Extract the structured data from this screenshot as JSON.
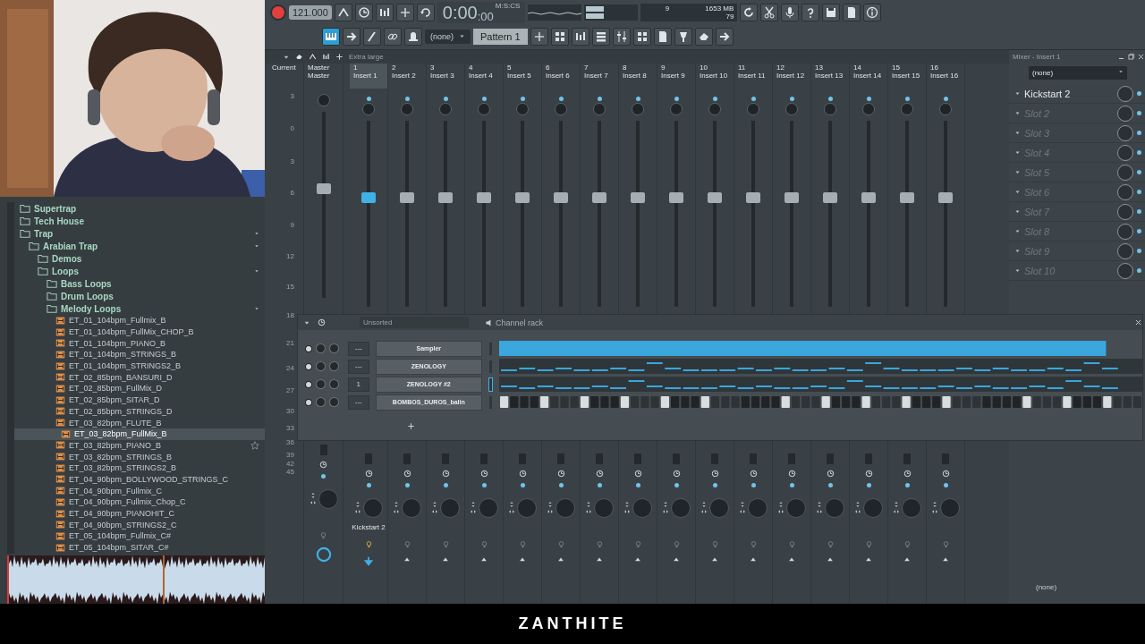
{
  "toolbar": {
    "tempo": "121.000",
    "time": "0:00",
    "time_cs": ":00",
    "time_format": "M:S:CS",
    "cpu": "9",
    "memory": "1653 MB",
    "polyphony": "79",
    "pattern_select": "(none)",
    "pattern": "Pattern 1"
  },
  "browser": {
    "tree": [
      {
        "name": "Supertrap",
        "kind": "folder",
        "expanded": false,
        "selected": false
      },
      {
        "name": "Tech House",
        "kind": "folder",
        "expanded": false,
        "selected": false
      },
      {
        "name": "Trap",
        "kind": "folder",
        "expanded": true,
        "selected": false,
        "children": [
          {
            "name": "Arabian Trap",
            "kind": "folder",
            "expanded": true,
            "selected": false,
            "children": [
              {
                "name": "Demos",
                "kind": "folder",
                "expanded": false,
                "selected": false
              },
              {
                "name": "Loops",
                "kind": "folder",
                "expanded": true,
                "selected": false,
                "children": [
                  {
                    "name": "Bass Loops",
                    "kind": "folder",
                    "expanded": false,
                    "selected": false
                  },
                  {
                    "name": "Drum Loops",
                    "kind": "folder",
                    "expanded": false,
                    "selected": false
                  },
                  {
                    "name": "Melody Loops",
                    "kind": "folder",
                    "expanded": true,
                    "selected": false,
                    "children": [
                      {
                        "name": "ET_01_104bpm_Fullmix_B",
                        "kind": "file",
                        "selected": false,
                        "favorite": false
                      },
                      {
                        "name": "ET_01_104bpm_FullMix_CHOP_B",
                        "kind": "file",
                        "selected": false,
                        "favorite": false
                      },
                      {
                        "name": "ET_01_104bpm_PIANO_B",
                        "kind": "file",
                        "selected": false,
                        "favorite": false
                      },
                      {
                        "name": "ET_01_104bpm_STRINGS_B",
                        "kind": "file",
                        "selected": false,
                        "favorite": false
                      },
                      {
                        "name": "ET_01_104bpm_STRINGS2_B",
                        "kind": "file",
                        "selected": false,
                        "favorite": false
                      },
                      {
                        "name": "ET_02_85bpm_BANSURI_D",
                        "kind": "file",
                        "selected": false,
                        "favorite": false
                      },
                      {
                        "name": "ET_02_85bpm_FullMix_D",
                        "kind": "file",
                        "selected": false,
                        "favorite": false
                      },
                      {
                        "name": "ET_02_85bpm_SITAR_D",
                        "kind": "file",
                        "selected": false,
                        "favorite": false
                      },
                      {
                        "name": "ET_02_85bpm_STRINGS_D",
                        "kind": "file",
                        "selected": false,
                        "favorite": false
                      },
                      {
                        "name": "ET_03_82bpm_FLUTE_B",
                        "kind": "file",
                        "selected": false,
                        "favorite": false
                      },
                      {
                        "name": "ET_03_82bpm_FullMix_B",
                        "kind": "file",
                        "selected": true,
                        "favorite": false
                      },
                      {
                        "name": "ET_03_82bpm_PIANO_B",
                        "kind": "file",
                        "selected": false,
                        "favorite": true
                      },
                      {
                        "name": "ET_03_82bpm_STRINGS_B",
                        "kind": "file",
                        "selected": false,
                        "favorite": false
                      },
                      {
                        "name": "ET_03_82bpm_STRINGS2_B",
                        "kind": "file",
                        "selected": false,
                        "favorite": false
                      },
                      {
                        "name": "ET_04_90bpm_BOLLYWOOD_STRINGS_C",
                        "kind": "file",
                        "selected": false,
                        "favorite": false
                      },
                      {
                        "name": "ET_04_90bpm_Fullmix_C",
                        "kind": "file",
                        "selected": false,
                        "favorite": false
                      },
                      {
                        "name": "ET_04_90bpm_Fullmix_Chop_C",
                        "kind": "file",
                        "selected": false,
                        "favorite": false
                      },
                      {
                        "name": "ET_04_90bpm_PIANOHIT_C",
                        "kind": "file",
                        "selected": false,
                        "favorite": false
                      },
                      {
                        "name": "ET_04_90bpm_STRINGS2_C",
                        "kind": "file",
                        "selected": false,
                        "favorite": false
                      },
                      {
                        "name": "ET_05_104bpm_Fullmix_C#",
                        "kind": "file",
                        "selected": false,
                        "favorite": false
                      },
                      {
                        "name": "ET_05_104bpm_SITAR_C#",
                        "kind": "file",
                        "selected": false,
                        "favorite": false
                      }
                    ]
                  }
                ]
              }
            ]
          }
        ]
      }
    ]
  },
  "mixer": {
    "size": "Extra large",
    "current": "Current",
    "master": {
      "number": "Master",
      "name": "Master"
    },
    "scale": [
      "3",
      "0",
      "3",
      "6",
      "9",
      "12",
      "15",
      "18",
      "21",
      "24",
      "27",
      "30",
      "33",
      "36",
      "39",
      "42",
      "45"
    ],
    "inserts": [
      {
        "number": "1",
        "name": "Insert 1",
        "selected": true,
        "label": "Kickstart 2"
      },
      {
        "number": "2",
        "name": "Insert 2",
        "selected": false
      },
      {
        "number": "3",
        "name": "Insert 3",
        "selected": false
      },
      {
        "number": "4",
        "name": "Insert 4",
        "selected": false
      },
      {
        "number": "5",
        "name": "Insert 5",
        "selected": false
      },
      {
        "number": "6",
        "name": "Insert 6",
        "selected": false
      },
      {
        "number": "7",
        "name": "Insert 7",
        "selected": false
      },
      {
        "number": "8",
        "name": "Insert 8",
        "selected": false
      },
      {
        "number": "9",
        "name": "Insert 9",
        "selected": false
      },
      {
        "number": "10",
        "name": "Insert 10",
        "selected": false
      },
      {
        "number": "11",
        "name": "Insert 11",
        "selected": false
      },
      {
        "number": "12",
        "name": "Insert 12",
        "selected": false
      },
      {
        "number": "13",
        "name": "Insert 13",
        "selected": false
      },
      {
        "number": "14",
        "name": "Insert 14",
        "selected": false
      },
      {
        "number": "15",
        "name": "Insert 15",
        "selected": false
      },
      {
        "number": "16",
        "name": "Insert 16",
        "selected": false
      }
    ]
  },
  "effects_panel": {
    "title": "Mixer - Insert 1",
    "preset": "(none)",
    "output": "(none)",
    "slots": [
      {
        "name": "Kickstart 2",
        "kind": "plugin"
      },
      {
        "name": "Slot 2",
        "kind": "empty"
      },
      {
        "name": "Slot 3",
        "kind": "empty"
      },
      {
        "name": "Slot 4",
        "kind": "empty"
      },
      {
        "name": "Slot 5",
        "kind": "empty"
      },
      {
        "name": "Slot 6",
        "kind": "empty"
      },
      {
        "name": "Slot 7",
        "kind": "empty"
      },
      {
        "name": "Slot 8",
        "kind": "empty"
      },
      {
        "name": "Slot 9",
        "kind": "empty"
      },
      {
        "name": "Slot 10",
        "kind": "empty"
      }
    ]
  },
  "channel_rack": {
    "filter": "Unsorted",
    "title": "Channel rack",
    "channels": [
      {
        "name": "Sampler",
        "route": "---",
        "kind": "clip",
        "selected": false
      },
      {
        "name": "ZENOLOGY",
        "route": "---",
        "kind": "notes",
        "selected": false
      },
      {
        "name": "ZENOLOGY #2",
        "route": "1",
        "kind": "notes",
        "selected": true
      },
      {
        "name": "BOMBOS_DUROS_balin",
        "route": "---",
        "kind": "steps",
        "selected": false,
        "steps": [
          true,
          false,
          false,
          false,
          true,
          false,
          false,
          false,
          true,
          false,
          false,
          false,
          true,
          false,
          false,
          false,
          true,
          false,
          false,
          false,
          true,
          false,
          false,
          false,
          false,
          false,
          false,
          false,
          true,
          false,
          false,
          false,
          true,
          false,
          false,
          false,
          true,
          false,
          false,
          false,
          true,
          false,
          false,
          false,
          true,
          false,
          false,
          false,
          false,
          false,
          false,
          false,
          true,
          false,
          false,
          false,
          true,
          false,
          false,
          false,
          true,
          false,
          false,
          false
        ]
      }
    ]
  },
  "caption": "ZANTHITE"
}
